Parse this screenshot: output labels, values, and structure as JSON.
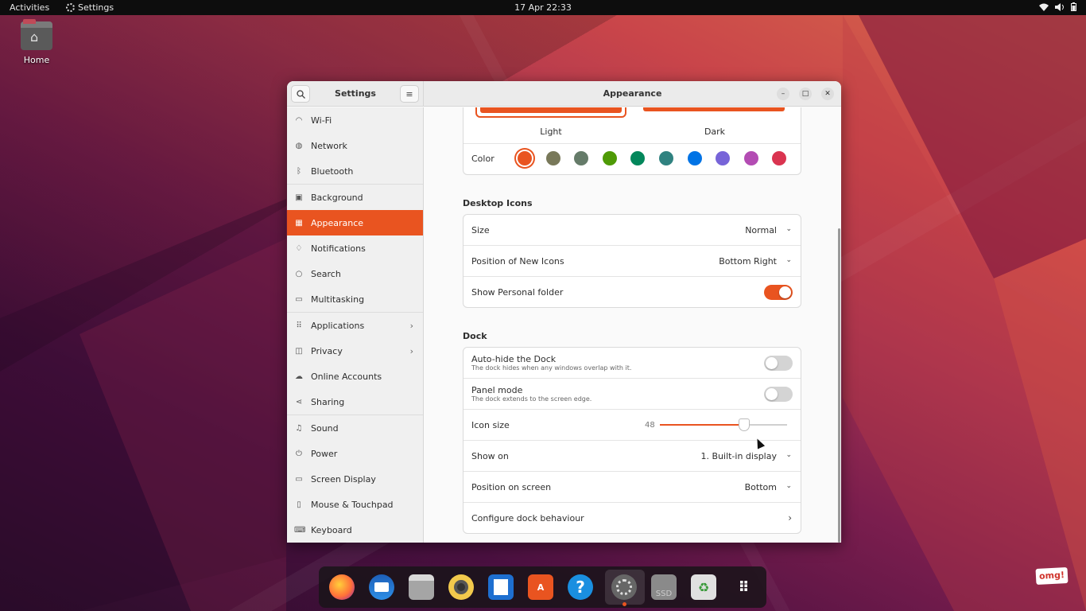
{
  "topbar": {
    "activities": "Activities",
    "app_name": "Settings",
    "clock": "17 Apr  22:33"
  },
  "desktop": {
    "home_label": "Home"
  },
  "window": {
    "sidebar_title": "Settings",
    "title": "Appearance"
  },
  "sidebar": {
    "items": [
      {
        "label": "Wi-Fi",
        "icon": "wifi-icon"
      },
      {
        "label": "Network",
        "icon": "globe-icon"
      },
      {
        "label": "Bluetooth",
        "icon": "bluetooth-icon"
      },
      {
        "label": "Background",
        "icon": "image-icon"
      },
      {
        "label": "Appearance",
        "icon": "appearance-icon"
      },
      {
        "label": "Notifications",
        "icon": "bell-icon"
      },
      {
        "label": "Search",
        "icon": "search-icon"
      },
      {
        "label": "Multitasking",
        "icon": "multitasking-icon"
      },
      {
        "label": "Applications",
        "icon": "apps-grid-icon"
      },
      {
        "label": "Privacy",
        "icon": "lock-icon"
      },
      {
        "label": "Online Accounts",
        "icon": "cloud-icon"
      },
      {
        "label": "Sharing",
        "icon": "share-icon"
      },
      {
        "label": "Sound",
        "icon": "music-note-icon"
      },
      {
        "label": "Power",
        "icon": "power-icon"
      },
      {
        "label": "Screen Display",
        "icon": "monitor-icon"
      },
      {
        "label": "Mouse & Touchpad",
        "icon": "mouse-icon"
      },
      {
        "label": "Keyboard",
        "icon": "keyboard-icon"
      }
    ],
    "active": "Appearance"
  },
  "style": {
    "light_label": "Light",
    "dark_label": "Dark",
    "color_label": "Color",
    "colors": [
      "#e95420",
      "#787859",
      "#657b69",
      "#4e9a06",
      "#03875b",
      "#308280",
      "#0073e5",
      "#7764d8",
      "#b34cb3",
      "#da3450"
    ],
    "selected_color": "#e95420"
  },
  "desktop_icons": {
    "title": "Desktop Icons",
    "size_label": "Size",
    "size_value": "Normal",
    "position_label": "Position of New Icons",
    "position_value": "Bottom Right",
    "personal_folder_label": "Show Personal folder",
    "personal_folder_on": true
  },
  "dock": {
    "title": "Dock",
    "autohide_label": "Auto-hide the Dock",
    "autohide_sub": "The dock hides when any windows overlap with it.",
    "autohide_on": false,
    "panel_label": "Panel mode",
    "panel_sub": "The dock extends to the screen edge.",
    "panel_on": false,
    "icon_size_label": "Icon size",
    "icon_size_value": "48",
    "icon_size_fraction": 0.66,
    "show_on_label": "Show on",
    "show_on_value": "1. Built-in display",
    "position_label": "Position on screen",
    "position_value": "Bottom",
    "configure_label": "Configure dock behaviour"
  },
  "dock_apps": [
    "firefox-icon",
    "thunderbird-icon",
    "files-icon",
    "rhythmbox-icon",
    "writer-icon",
    "app-center-icon",
    "help-icon",
    "settings-icon",
    "drive-icon",
    "trash-icon",
    "show-apps-icon"
  ],
  "dock_labels": {
    "drive": "SSD"
  },
  "watermark": "omg!",
  "accent": "#e95420"
}
